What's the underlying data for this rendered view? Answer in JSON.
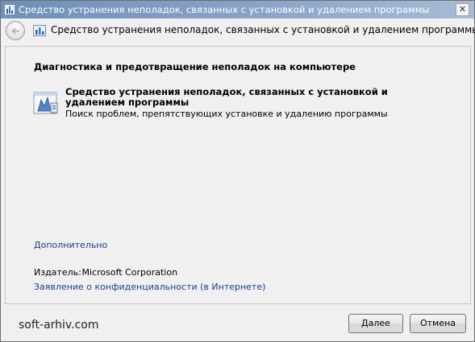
{
  "window": {
    "title": "Средство устранения неполадок, связанных с установкой и удалением программы"
  },
  "header": {
    "title": "Средство устранения неполадок, связанных с установкой и удалением программы"
  },
  "main": {
    "section_heading": "Диагностика и предотвращение неполадок на компьютере",
    "tool": {
      "name": "Средство устранения неполадок, связанных с установкой и удалением программы",
      "description": "Поиск проблем, препятствующих установке и удалению программы",
      "icon": "program-install-troubleshooter-icon"
    },
    "advanced_link": "Дополнительно",
    "publisher_label": "Издатель:",
    "publisher_value": "Microsoft Corporation",
    "privacy_link": "Заявление о конфиденциальности (в Интернете)"
  },
  "footer": {
    "watermark": "soft-arhiv.com",
    "next_label": "Далее",
    "cancel_label": "Отмена"
  },
  "icons": {
    "close": "close-icon",
    "back": "back-arrow-icon",
    "app": "troubleshooter-icon"
  },
  "colors": {
    "link": "#1a3e8f",
    "titlebar": "#8aa4c8",
    "window_bg": "#f0f0f0"
  }
}
